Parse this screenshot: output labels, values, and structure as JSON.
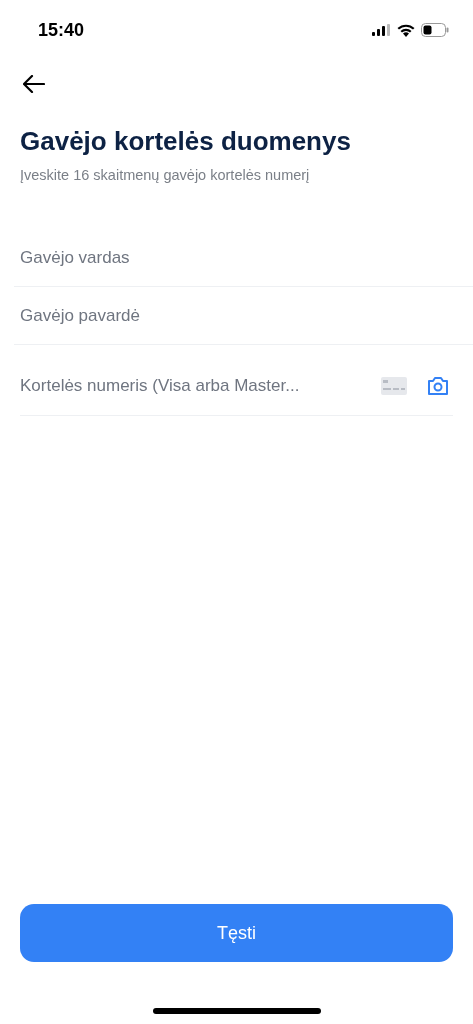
{
  "status_bar": {
    "time": "15:40"
  },
  "title": "Gavėjo kortelės duomenys",
  "subtitle": "Įveskite 16 skaitmenų gavėjo kortelės numerį",
  "fields": [
    {
      "kind": "plain",
      "placeholder": "Gavėjo vardas"
    },
    {
      "kind": "plain",
      "placeholder": "Gavėjo pavardė"
    },
    {
      "kind": "card",
      "placeholder": "Kortelės numeris (Visa arba Master..."
    }
  ],
  "button": "Tęsti"
}
